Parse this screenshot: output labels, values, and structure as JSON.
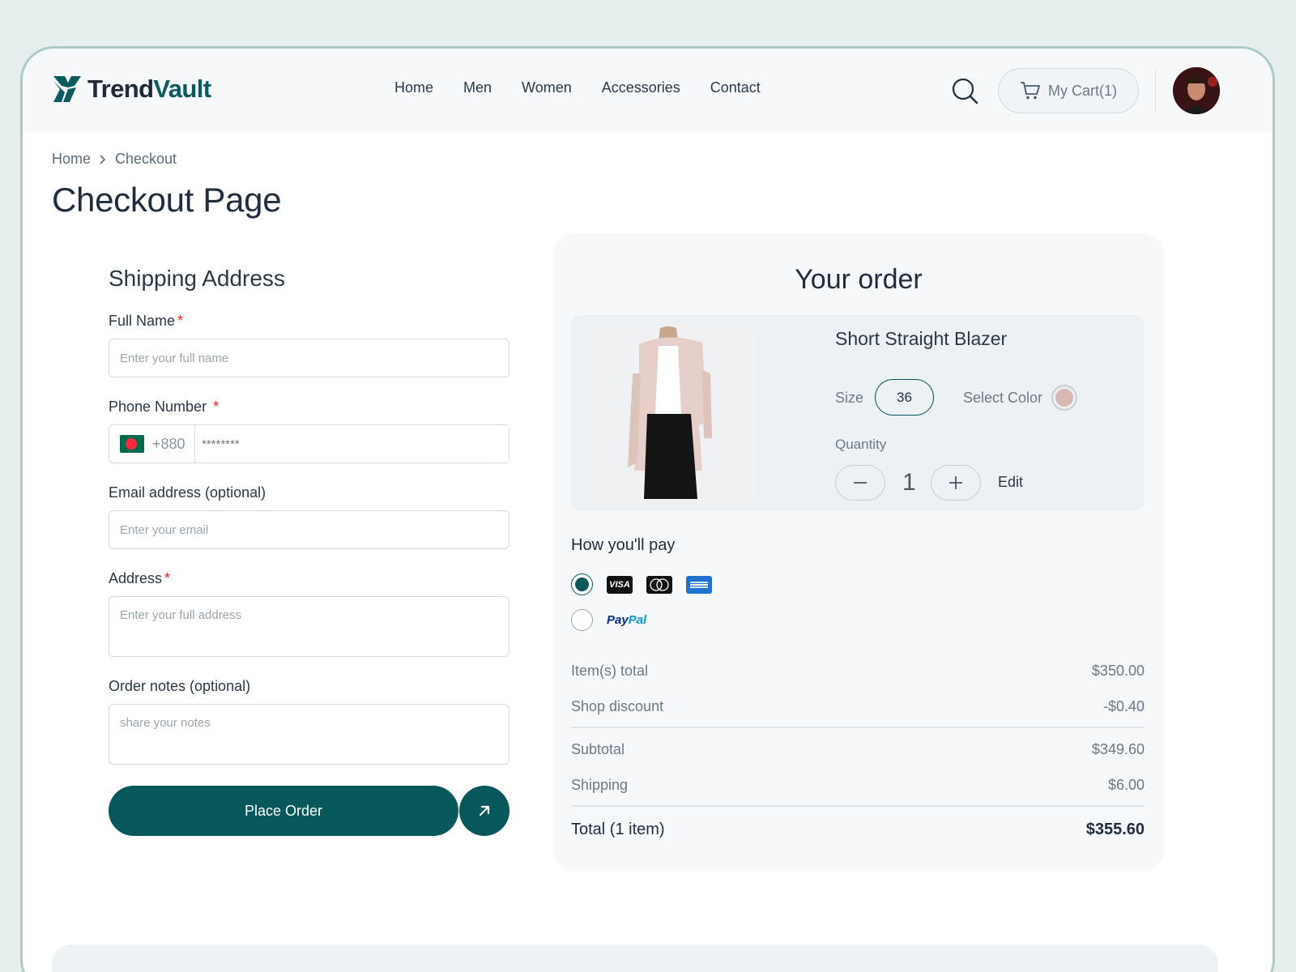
{
  "brand": {
    "name_part1": "Trend",
    "name_part2": "Vault",
    "color": "#07575b"
  },
  "nav": {
    "items": [
      "Home",
      "Men",
      "Women",
      "Accessories",
      "Contact"
    ]
  },
  "header": {
    "cart_label": "My Cart(1)",
    "search_icon": "search-icon",
    "cart_icon": "cart-icon"
  },
  "breadcrumb": {
    "home": "Home",
    "current": "Checkout"
  },
  "page": {
    "title": "Checkout Page"
  },
  "shipping": {
    "title": "Shipping Address",
    "full_name": {
      "label": "Full Name",
      "required": "*",
      "placeholder": "Enter your full name"
    },
    "phone": {
      "label": "Phone Number",
      "required": "*",
      "country_code": "+880",
      "placeholder": "********"
    },
    "email": {
      "label": "Email address (optional)",
      "placeholder": "Enter your email"
    },
    "address": {
      "label": "Address",
      "required": "*",
      "placeholder": "Enter your full address"
    },
    "notes": {
      "label": "Order notes (optional)",
      "placeholder": "share your notes"
    },
    "place_order_label": "Place Order"
  },
  "order": {
    "title": "Your order",
    "product": {
      "name": "Short Straight Blazer",
      "size_label": "Size",
      "size_value": "36",
      "color_label": "Select Color",
      "color_value": "#d8b8b4",
      "quantity_label": "Quantity",
      "quantity": "1",
      "edit_label": "Edit"
    },
    "payment": {
      "title": "How you'll pay",
      "card_visa": "VISA",
      "paypal_a": "Pay",
      "paypal_b": "Pal",
      "selected": "card"
    },
    "summary": {
      "items_total_label": "Item(s) total",
      "items_total": "$350.00",
      "discount_label": "Shop discount",
      "discount": "-$0.40",
      "subtotal_label": "Subtotal",
      "subtotal": "$349.60",
      "shipping_label": "Shipping",
      "shipping": "$6.00",
      "total_label": "Total (1 item)",
      "total": "$355.60"
    }
  }
}
